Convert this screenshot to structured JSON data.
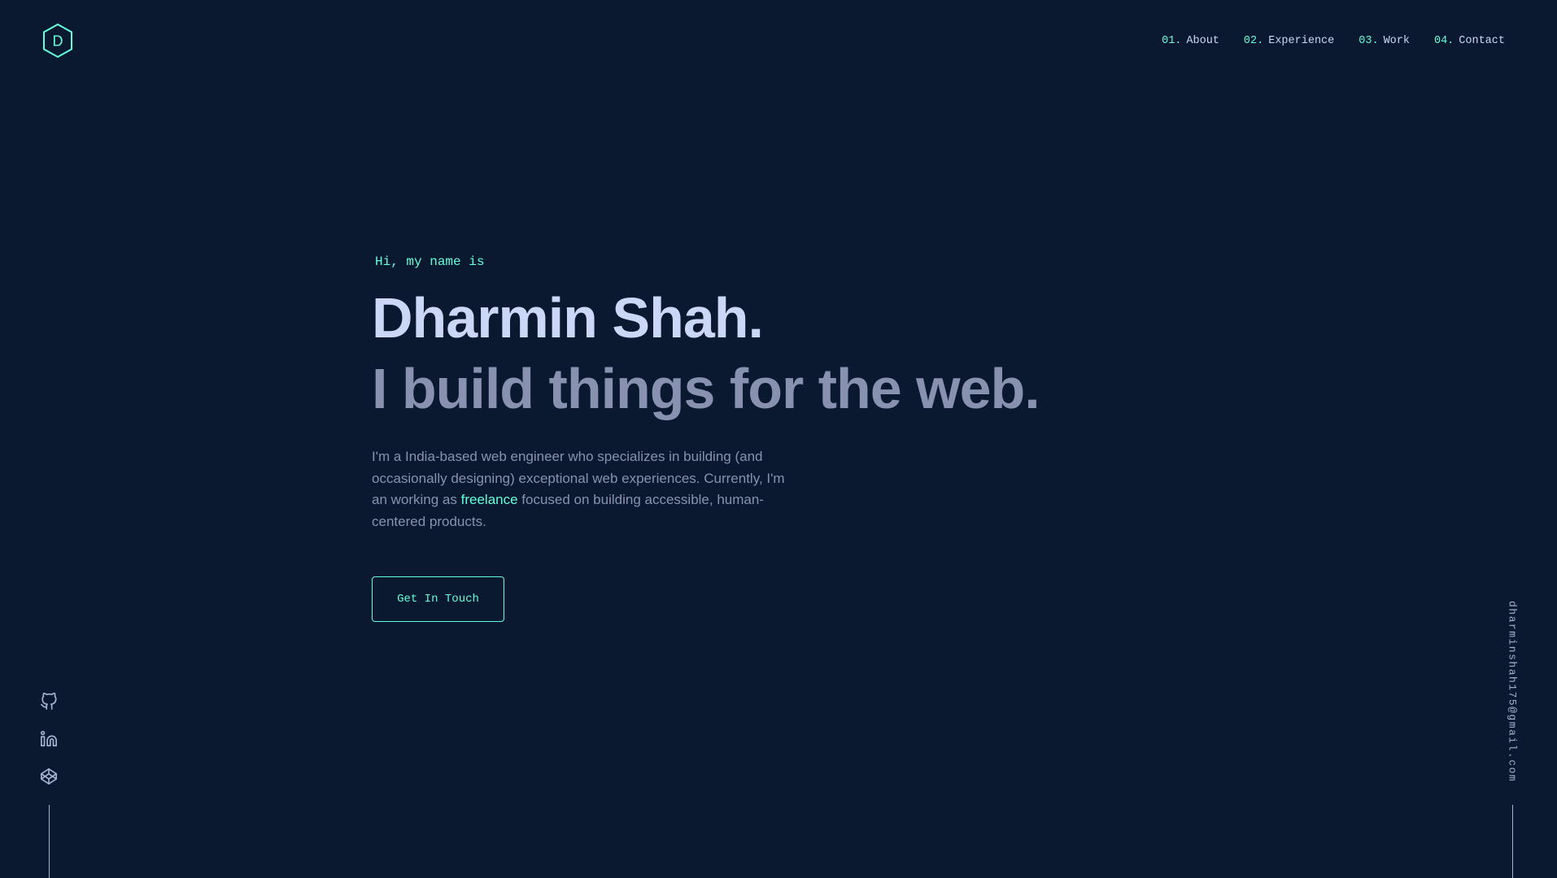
{
  "colors": {
    "background": "#0a192f",
    "accent": "#64ffda",
    "heading": "#ccd6f6",
    "body": "#8892b0"
  },
  "logo": {
    "letter": "D",
    "icon": "hexagon-logo-icon"
  },
  "nav": {
    "items": [
      {
        "num": "01.",
        "label": "About"
      },
      {
        "num": "02.",
        "label": "Experience"
      },
      {
        "num": "03.",
        "label": "Work"
      },
      {
        "num": "04.",
        "label": "Contact"
      }
    ]
  },
  "hero": {
    "greeting": "Hi, my name is",
    "name": "Dharmin Shah.",
    "tagline": "I build things for the web.",
    "desc_before": "I'm a India-based web engineer who specializes in building (and occasionally designing) exceptional web experiences. Currently, I'm an working as ",
    "desc_highlight": "freelance",
    "desc_after": " focused on building accessible, human-centered products.",
    "cta": "Get In Touch"
  },
  "socials": [
    {
      "icon": "github-icon"
    },
    {
      "icon": "linkedin-icon"
    },
    {
      "icon": "codepen-icon"
    }
  ],
  "email": "dharminshah175@gmail.com"
}
